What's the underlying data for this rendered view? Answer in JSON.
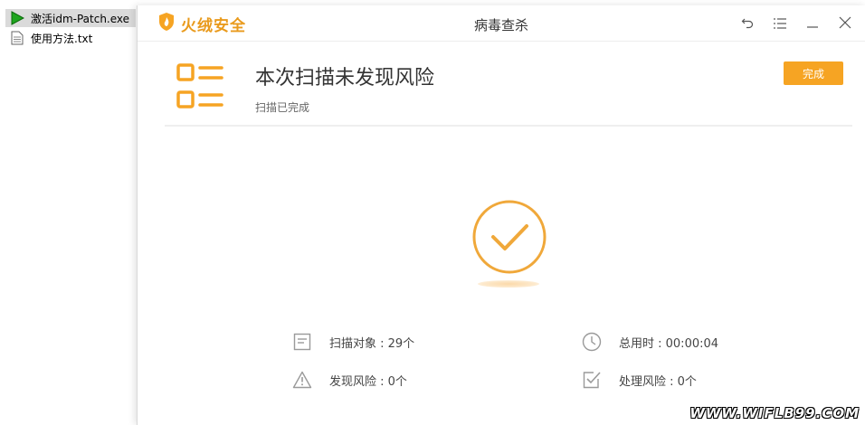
{
  "explorer": {
    "files": [
      {
        "name": "激活idm-Patch.exe",
        "icon": "green-play-icon",
        "selected": true
      },
      {
        "name": "使用方法.txt",
        "icon": "text-file-icon",
        "selected": false
      }
    ]
  },
  "dialog": {
    "brand": "火绒安全",
    "title": "病毒查杀",
    "headline": "本次扫描未发现风险",
    "subline": "扫描已完成",
    "done_label": "完成",
    "stats": {
      "scan_objects": "扫描对象 : 29个",
      "total_time": "总用时 : 00:00:04",
      "risks_found": "发现风险 : 0个",
      "risks_handled": "处理风险 : 0个"
    }
  },
  "watermark": "WWW.WIFLB99.COM",
  "colors": {
    "accent": "#f6a423",
    "brand_orange": "#e99a1c",
    "icon_gray": "#9a9a9a"
  }
}
